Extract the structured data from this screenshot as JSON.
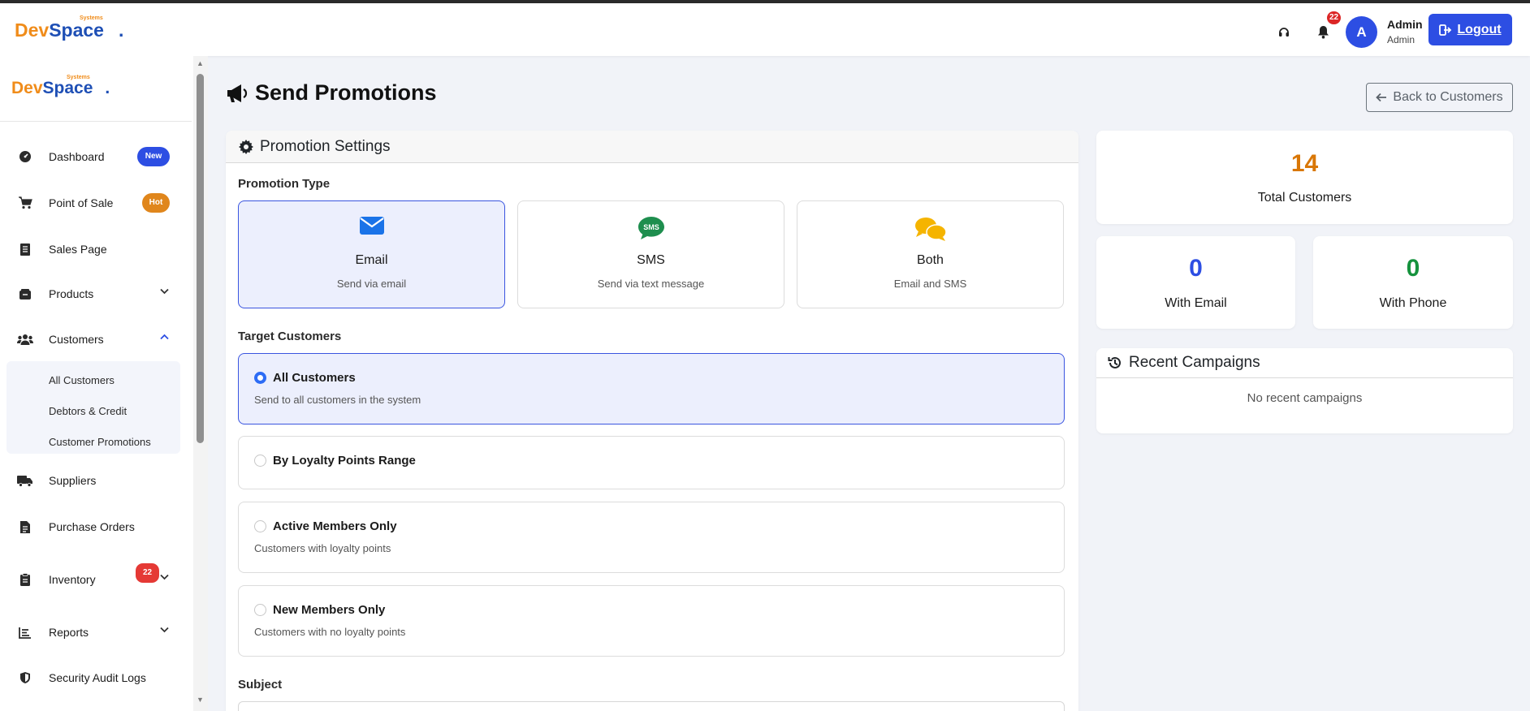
{
  "brand": {
    "name_part1": "Dev",
    "name_part2": "Space",
    "tagline": "Systems",
    "dot": "."
  },
  "header": {
    "notification_count": "22",
    "avatar_initial": "A",
    "user_name": "Admin",
    "user_role": "Admin",
    "logout_label": "Logout"
  },
  "sidebar": {
    "items": [
      {
        "label": "Dashboard",
        "icon": "dashboard-gauge-icon",
        "badge": "New"
      },
      {
        "label": "Point of Sale",
        "icon": "cart-icon",
        "badge": "Hot"
      },
      {
        "label": "Sales Page",
        "icon": "receipt-icon"
      },
      {
        "label": "Products",
        "icon": "box-icon"
      },
      {
        "label": "Customers",
        "icon": "users-icon"
      },
      {
        "label": "Suppliers",
        "icon": "truck-icon"
      },
      {
        "label": "Purchase Orders",
        "icon": "document-icon"
      },
      {
        "label": "Inventory",
        "icon": "clipboard-icon",
        "badge": "22"
      },
      {
        "label": "Reports",
        "icon": "chart-icon"
      },
      {
        "label": "Security Audit Logs",
        "icon": "shield-icon"
      }
    ],
    "customers_submenu": [
      "All Customers",
      "Debtors & Credit",
      "Customer Promotions"
    ]
  },
  "page": {
    "title": "Send Promotions",
    "back_label": "Back to Customers"
  },
  "settings": {
    "header": "Promotion Settings",
    "promotion_type_label": "Promotion Type",
    "types": [
      {
        "title": "Email",
        "desc": "Send via email",
        "selected": true
      },
      {
        "title": "SMS",
        "desc": "Send via text message",
        "icon_text": "SMS"
      },
      {
        "title": "Both",
        "desc": "Email and SMS"
      }
    ],
    "target_label": "Target Customers",
    "targets": [
      {
        "title": "All Customers",
        "desc": "Send to all customers in the system",
        "selected": true
      },
      {
        "title": "By Loyalty Points Range"
      },
      {
        "title": "Active Members Only",
        "desc": "Customers with loyalty points"
      },
      {
        "title": "New Members Only",
        "desc": "Customers with no loyalty points"
      }
    ],
    "subject_label": "Subject"
  },
  "stats": {
    "total_customers": {
      "value": "14",
      "label": "Total Customers",
      "color": "#d97706"
    },
    "with_email": {
      "value": "0",
      "label": "With Email",
      "color": "#2d4ee3"
    },
    "with_phone": {
      "value": "0",
      "label": "With Phone",
      "color": "#15923d"
    }
  },
  "recent": {
    "header": "Recent Campaigns",
    "empty_text": "No recent campaigns"
  },
  "colors": {
    "primary": "#2d4ee3",
    "brand_orange": "#f08c1a",
    "brand_blue": "#1e4fb5",
    "danger": "#dc2626"
  }
}
